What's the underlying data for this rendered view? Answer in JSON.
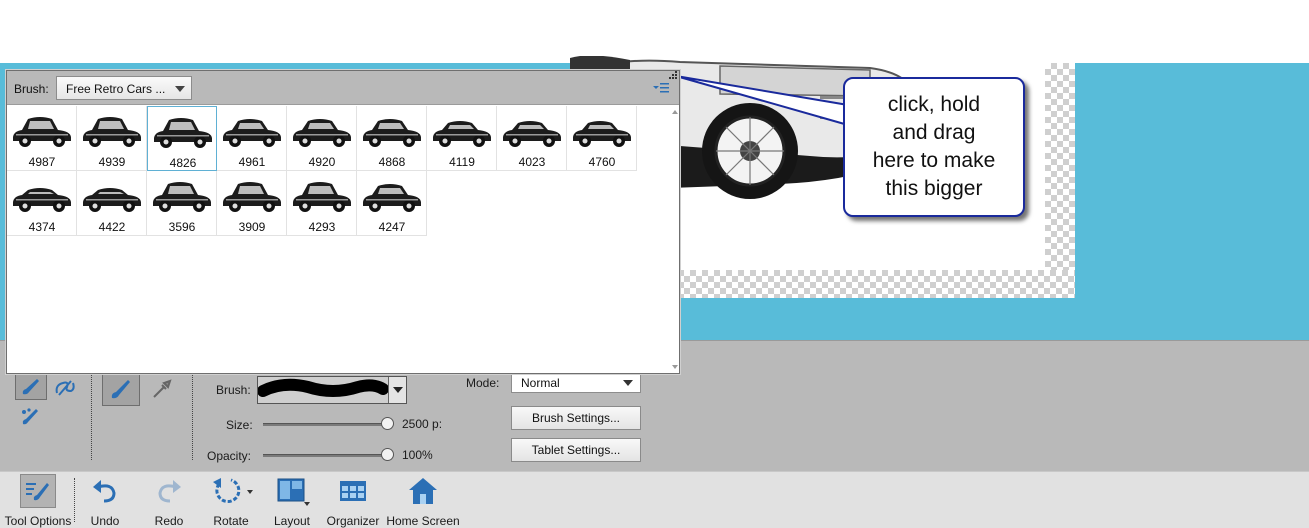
{
  "brush_picker": {
    "brush_label": "Brush:",
    "set_name": "Free Retro Cars ...",
    "brushes": [
      {
        "size": "4987"
      },
      {
        "size": "4939"
      },
      {
        "size": "4826"
      },
      {
        "size": "4961"
      },
      {
        "size": "4920"
      },
      {
        "size": "4868"
      },
      {
        "size": "4119"
      },
      {
        "size": "4023"
      },
      {
        "size": "4760"
      },
      {
        "size": "4374"
      },
      {
        "size": "4422"
      },
      {
        "size": "3596"
      },
      {
        "size": "3909"
      },
      {
        "size": "4293"
      },
      {
        "size": "4247"
      }
    ],
    "selected_index": 2
  },
  "callout": {
    "text": "click, hold\nand drag\nhere to make\nthis bigger"
  },
  "tool_options": {
    "brush_label": "Brush:",
    "size_label": "Size:",
    "size_value": "2500 p:",
    "size_fraction": 1.0,
    "opacity_label": "Opacity:",
    "opacity_value": "100%",
    "opacity_fraction": 1.0,
    "mode_label": "Mode:",
    "mode_value": "Normal",
    "brush_settings": "Brush Settings...",
    "tablet_settings": "Tablet Settings..."
  },
  "taskbar": {
    "tool_options": "Tool Options",
    "undo": "Undo",
    "redo": "Redo",
    "rotate": "Rotate",
    "layout": "Layout",
    "organizer": "Organizer",
    "home_screen": "Home Screen"
  },
  "colors": {
    "canvas_blue": "#58bcd9",
    "panel_gray": "#b9b9b9",
    "callout_border": "#1a2a9c",
    "selection_blue": "#5fb0d4"
  }
}
